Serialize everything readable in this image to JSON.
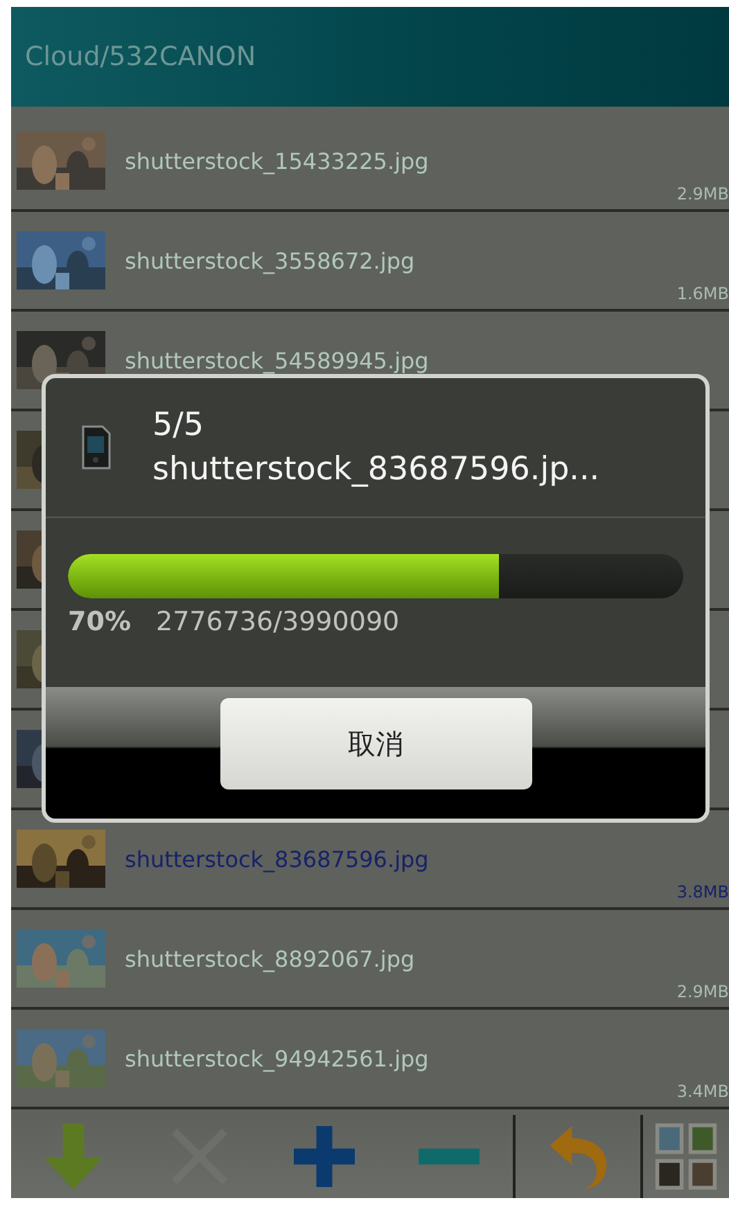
{
  "title": "Cloud/532CANON",
  "files": [
    {
      "kind": "picture",
      "name": "shutterstock_15433225.jpg",
      "size": "2.9MB",
      "selected": false
    },
    {
      "kind": "picture",
      "name": "shutterstock_3558672.jpg",
      "size": "1.6MB",
      "selected": false
    },
    {
      "kind": "picture",
      "name": "shutterstock_54589945.jpg",
      "selected": false
    },
    {
      "kind": "picture"
    },
    {
      "kind": "picture"
    },
    {
      "kind": "picture"
    },
    {
      "kind": "picture"
    },
    {
      "kind": "picture",
      "name": "shutterstock_83687596.jpg",
      "size": "3.8MB",
      "selected": true
    },
    {
      "kind": "picture",
      "name": "shutterstock_8892067.jpg",
      "size": "2.9MB",
      "selected": false
    },
    {
      "kind": "picture",
      "name": "shutterstock_94942561.jpg",
      "size": "3.4MB",
      "selected": false
    }
  ],
  "dialog": {
    "counter": "5/5",
    "filename": "shutterstock_83687596.jp...",
    "level": 0.7,
    "percent": "70%",
    "bytes": "2776736/3990090",
    "cancel": "取消"
  },
  "toolbar": [
    {
      "kind": "download",
      "disabled": false
    },
    {
      "kind": "delete",
      "disabled": true
    },
    {
      "kind": "add",
      "disabled": false
    },
    {
      "kind": "remove",
      "disabled": false
    },
    {
      "kind": "back",
      "disabled": false
    },
    {
      "kind": "gallery",
      "disabled": false
    }
  ]
}
